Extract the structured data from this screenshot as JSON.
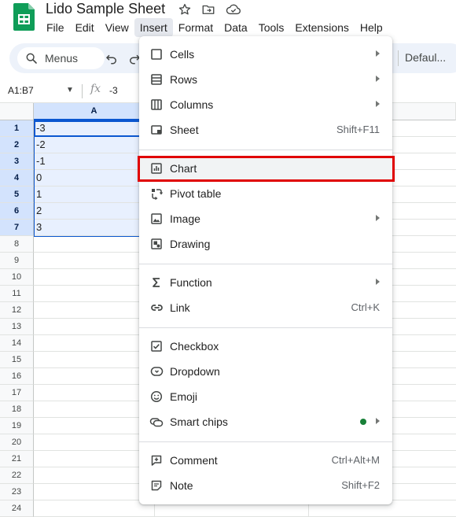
{
  "app": {
    "doc_title": "Lido Sample Sheet",
    "logo_icon": "sheets-logo-icon",
    "accent_color": "#0f9d58"
  },
  "menubar": {
    "items": [
      "File",
      "Edit",
      "View",
      "Insert",
      "Format",
      "Data",
      "Tools",
      "Extensions",
      "Help"
    ],
    "active": "Insert"
  },
  "toolbar": {
    "search_label": "Menus",
    "font_label": "Defaul..."
  },
  "formula_bar": {
    "name_box": "A1:B7",
    "fx_label": "fx",
    "value": "-3"
  },
  "grid": {
    "columns": [
      "A"
    ],
    "selected_range_color": "#0b57d0",
    "rows": [
      {
        "num": "1",
        "a": "-3"
      },
      {
        "num": "2",
        "a": "-2"
      },
      {
        "num": "3",
        "a": "-1"
      },
      {
        "num": "4",
        "a": "0"
      },
      {
        "num": "5",
        "a": "1"
      },
      {
        "num": "6",
        "a": "2"
      },
      {
        "num": "7",
        "a": "3"
      },
      {
        "num": "8",
        "a": ""
      },
      {
        "num": "9",
        "a": ""
      },
      {
        "num": "10",
        "a": ""
      },
      {
        "num": "11",
        "a": ""
      },
      {
        "num": "12",
        "a": ""
      },
      {
        "num": "13",
        "a": ""
      },
      {
        "num": "14",
        "a": ""
      },
      {
        "num": "15",
        "a": ""
      },
      {
        "num": "16",
        "a": ""
      },
      {
        "num": "17",
        "a": ""
      },
      {
        "num": "18",
        "a": ""
      },
      {
        "num": "19",
        "a": ""
      },
      {
        "num": "20",
        "a": ""
      },
      {
        "num": "21",
        "a": ""
      },
      {
        "num": "22",
        "a": ""
      },
      {
        "num": "23",
        "a": ""
      },
      {
        "num": "24",
        "a": ""
      }
    ]
  },
  "insert_menu": {
    "highlight_color": "#e00000",
    "items": [
      {
        "label": "Cells",
        "shortcut": "",
        "icon": "cells-icon",
        "submenu": true
      },
      {
        "label": "Rows",
        "shortcut": "",
        "icon": "rows-icon",
        "submenu": true
      },
      {
        "label": "Columns",
        "shortcut": "",
        "icon": "columns-icon",
        "submenu": true
      },
      {
        "label": "Sheet",
        "shortcut": "Shift+F11",
        "icon": "sheet-icon",
        "submenu": false
      },
      {
        "label": "Chart",
        "shortcut": "",
        "icon": "chart-icon",
        "submenu": false
      },
      {
        "label": "Pivot table",
        "shortcut": "",
        "icon": "pivot-table-icon",
        "submenu": false
      },
      {
        "label": "Image",
        "shortcut": "",
        "icon": "image-icon",
        "submenu": true
      },
      {
        "label": "Drawing",
        "shortcut": "",
        "icon": "drawing-icon",
        "submenu": false
      },
      {
        "label": "Function",
        "shortcut": "",
        "icon": "function-icon",
        "submenu": true
      },
      {
        "label": "Link",
        "shortcut": "Ctrl+K",
        "icon": "link-icon",
        "submenu": false
      },
      {
        "label": "Checkbox",
        "shortcut": "",
        "icon": "checkbox-icon",
        "submenu": false
      },
      {
        "label": "Dropdown",
        "shortcut": "",
        "icon": "dropdown-icon",
        "submenu": false
      },
      {
        "label": "Emoji",
        "shortcut": "",
        "icon": "emoji-icon",
        "submenu": false
      },
      {
        "label": "Smart chips",
        "shortcut": "",
        "icon": "smart-chips-icon",
        "submenu": true
      },
      {
        "label": "Comment",
        "shortcut": "Ctrl+Alt+M",
        "icon": "comment-icon",
        "submenu": false
      },
      {
        "label": "Note",
        "shortcut": "Shift+F2",
        "icon": "note-icon",
        "submenu": false
      }
    ]
  }
}
